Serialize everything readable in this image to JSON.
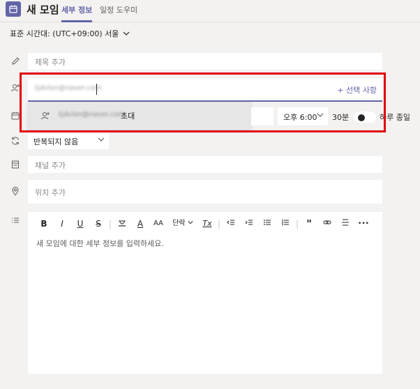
{
  "header": {
    "title": "새 모임",
    "tabs": [
      {
        "label": "세부 정보",
        "active": true
      },
      {
        "label": "일정 도우미",
        "active": false
      }
    ]
  },
  "timezone": {
    "label": "표준 시간대: (UTC+09:00) 서울"
  },
  "title_field": {
    "placeholder": "제목 추가"
  },
  "attendees": {
    "value": "tjdvlsn@naver.com",
    "optional_link": "+ 선택 사항",
    "suggestion": {
      "email": "tjdvlsn@naver.com",
      "action": "초대"
    }
  },
  "datetime": {
    "end_time": "오후 6:00",
    "duration": "30분",
    "all_day_label": "하루 종일",
    "all_day_on": false
  },
  "repeat": {
    "value": "반복되지 않음"
  },
  "channel_field": {
    "placeholder": "채널 추가"
  },
  "location_field": {
    "placeholder": "위치 추가"
  },
  "editor": {
    "toolbar": {
      "bold": "B",
      "italic": "I",
      "underline": "U",
      "strike": "S",
      "highlight": "A",
      "font_color": "A",
      "font_size": "AA",
      "paragraph": "단락",
      "clear_format": "Tx",
      "more": "•••"
    },
    "placeholder": "새 모임에 대한 세부 정보를 입력하세요."
  },
  "colors": {
    "accent": "#6264a7",
    "highlight_box": "#e00000",
    "background": "#f3f2f1"
  }
}
